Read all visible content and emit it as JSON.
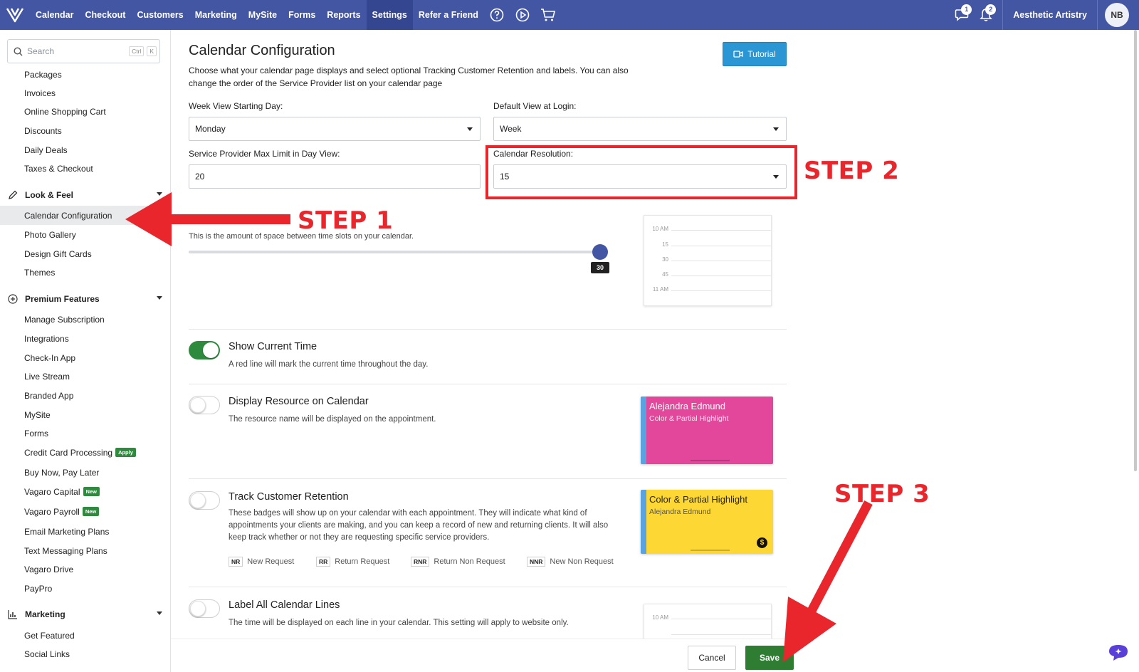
{
  "topnav": {
    "items": [
      {
        "label": "Calendar"
      },
      {
        "label": "Checkout"
      },
      {
        "label": "Customers"
      },
      {
        "label": "Marketing"
      },
      {
        "label": "MySite"
      },
      {
        "label": "Forms"
      },
      {
        "label": "Reports"
      },
      {
        "label": "Settings",
        "active": true
      },
      {
        "label": "Refer a Friend"
      }
    ],
    "icons": [
      "help-icon",
      "play-icon",
      "cart-icon"
    ],
    "messages_count": "1",
    "notifications_count": "2",
    "business_name": "Aesthetic Artistry",
    "avatar_initials": "NB"
  },
  "sidebar": {
    "search_placeholder": "Search",
    "shortcut_ctrl": "Ctrl",
    "shortcut_key": "K",
    "items_top": [
      "Packages",
      "Invoices",
      "Online Shopping Cart",
      "Discounts",
      "Daily Deals",
      "Taxes & Checkout"
    ],
    "look_feel": {
      "title": "Look & Feel",
      "items": [
        "Calendar Configuration",
        "Photo Gallery",
        "Design Gift Cards",
        "Themes"
      ]
    },
    "premium": {
      "title": "Premium Features",
      "items": [
        "Manage Subscription",
        "Integrations",
        "Check-In App",
        "Live Stream",
        "Branded App",
        "MySite",
        "Forms",
        "Credit Card Processing",
        "Buy Now, Pay Later",
        "Vagaro Capital",
        "Vagaro Payroll",
        "Email Marketing Plans",
        "Text Messaging Plans",
        "Vagaro Drive",
        "PayPro"
      ],
      "tag_apply": "Apply",
      "tag_new": "New"
    },
    "marketing": {
      "title": "Marketing",
      "items": [
        "Get Featured",
        "Social Links"
      ]
    }
  },
  "main": {
    "title": "Calendar Configuration",
    "description": "Choose what your calendar page displays and select optional Tracking Customer Retention and labels. You can also change the order of the Service Provider list on your calendar page",
    "tutorial_label": "Tutorial",
    "week_start_label": "Week View Starting Day:",
    "week_start_value": "Monday",
    "default_view_label": "Default View at Login:",
    "default_view_value": "Week",
    "max_limit_label": "Service Provider Max Limit in Day View:",
    "max_limit_value": "20",
    "resolution_label": "Calendar Resolution:",
    "resolution_value": "15",
    "slider_description": "This is the amount of space between time slots on your calendar.",
    "slider_value": "30",
    "preview_times": [
      "10 AM",
      "15",
      "30",
      "45",
      "11 AM"
    ],
    "options": [
      {
        "title": "Show Current Time",
        "desc": "A red line will mark the current time throughout the day.",
        "on": true
      },
      {
        "title": "Display Resource on Calendar",
        "desc": "The resource name will be displayed on the appointment.",
        "on": false
      },
      {
        "title": "Track Customer Retention",
        "desc": "These badges will show up on your calendar with each appointment. They will indicate what kind of appointments your clients are making, and you can keep a record of new and returning clients. It will also keep track whether or not they are requesting specific service providers.",
        "on": false
      },
      {
        "title": "Label All Calendar Lines",
        "desc": "The time will be displayed on each line in your calendar. This setting will apply to website only.",
        "on": false
      }
    ],
    "legend": [
      {
        "code": "NR",
        "label": "New Request"
      },
      {
        "code": "RR",
        "label": "Return Request"
      },
      {
        "code": "RNR",
        "label": "Return Non Request"
      },
      {
        "code": "NNR",
        "label": "New Non Request"
      }
    ],
    "card_pink": {
      "name": "Alejandra Edmund",
      "sub": "Color & Partial Highlight",
      "color": "#e3479b"
    },
    "card_yellow": {
      "name": "Color & Partial Highlight",
      "sub": "Alejandra Edmund",
      "color": "#fdd734",
      "dollar": "$"
    },
    "preview2_time": "10 AM"
  },
  "footer": {
    "cancel_label": "Cancel",
    "save_label": "Save"
  },
  "annotations": {
    "step1": "STEP 1",
    "step2": "STEP 2",
    "step3": "STEP 3",
    "color": "#e8262c"
  },
  "colors": {
    "nav": "#4356a3",
    "toggle_on": "#2e8b3d",
    "save": "#2e7d33",
    "tutorial": "#2a97d4"
  }
}
